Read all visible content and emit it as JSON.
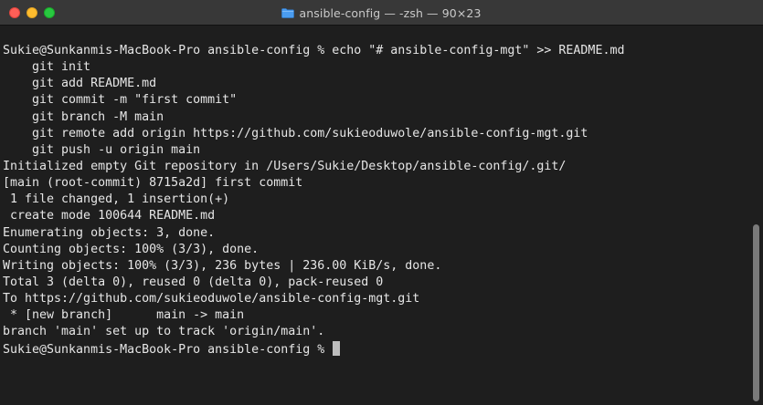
{
  "window": {
    "title": "ansible-config — -zsh — 90×23",
    "folder_icon": "folder-icon"
  },
  "colors": {
    "background": "#1e1e1e",
    "text": "#e6e6e6",
    "titlebar": "#383838",
    "close": "#ff5f57",
    "minimize": "#febc2e",
    "maximize": "#28c840",
    "folder": "#4a9cf0"
  },
  "terminal": {
    "lines": [
      "Sukie@Sunkanmis-MacBook-Pro ansible-config % echo \"# ansible-config-mgt\" >> README.md",
      "    git init",
      "    git add README.md",
      "    git commit -m \"first commit\"",
      "    git branch -M main",
      "    git remote add origin https://github.com/sukieoduwole/ansible-config-mgt.git",
      "    git push -u origin main",
      "Initialized empty Git repository in /Users/Sukie/Desktop/ansible-config/.git/",
      "[main (root-commit) 8715a2d] first commit",
      " 1 file changed, 1 insertion(+)",
      " create mode 100644 README.md",
      "Enumerating objects: 3, done.",
      "Counting objects: 100% (3/3), done.",
      "Writing objects: 100% (3/3), 236 bytes | 236.00 KiB/s, done.",
      "Total 3 (delta 0), reused 0 (delta 0), pack-reused 0",
      "To https://github.com/sukieoduwole/ansible-config-mgt.git",
      " * [new branch]      main -> main",
      "branch 'main' set up to track 'origin/main'."
    ],
    "prompt": "Sukie@Sunkanmis-MacBook-Pro ansible-config % "
  }
}
